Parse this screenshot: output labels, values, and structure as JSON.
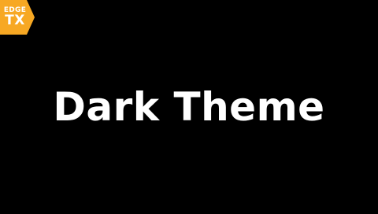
{
  "logo": {
    "line1": "EDGE",
    "line2": "TX",
    "color": "#f7a823",
    "icon": "edgetx-logo-icon"
  },
  "screen": {
    "title": "Dark Theme",
    "background": "#000000",
    "text_color": "#ffffff"
  }
}
